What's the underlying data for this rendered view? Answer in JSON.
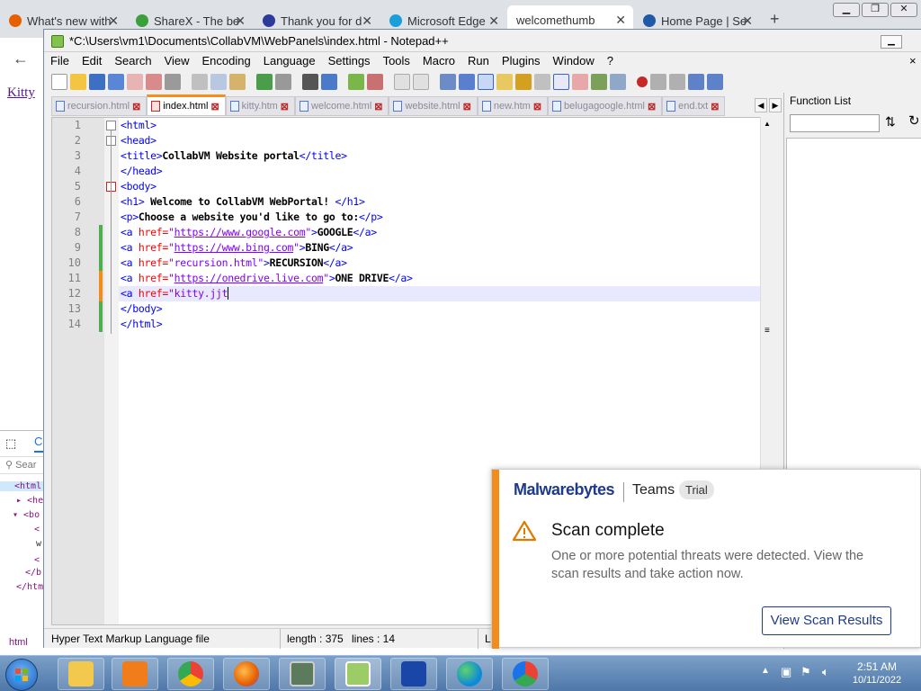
{
  "browser": {
    "tabs": [
      {
        "title": "What's new with",
        "color": "#e66000"
      },
      {
        "title": "ShareX - The be",
        "color": "#3b9f3b"
      },
      {
        "title": "Thank you for d",
        "color": "#2b3a9b"
      },
      {
        "title": "Microsoft Edge",
        "color": "#1a9fd9"
      },
      {
        "title": "welcomethumb",
        "color": ""
      },
      {
        "title": "Home Page | Se",
        "color": "#1e5aa8"
      }
    ],
    "page_link": "Kitty",
    "devtools": {
      "search_placeholder": "Sear",
      "tree": [
        "<html",
        "▸ <he",
        "▾ <bo",
        "<",
        "w",
        "<",
        "</b",
        "</htm"
      ],
      "breadcrumb": "html"
    }
  },
  "notepadpp": {
    "title": "*C:\\Users\\vm1\\Documents\\CollabVM\\WebPanels\\index.html - Notepad++",
    "menu": [
      "File",
      "Edit",
      "Search",
      "View",
      "Encoding",
      "Language",
      "Settings",
      "Tools",
      "Macro",
      "Run",
      "Plugins",
      "Window",
      "?"
    ],
    "menu_close": "×",
    "tabs": [
      {
        "name": "recursion.html",
        "active": false
      },
      {
        "name": "index.html",
        "active": true
      },
      {
        "name": "kitty.htm",
        "active": false
      },
      {
        "name": "welcome.html",
        "active": false
      },
      {
        "name": "website.html",
        "active": false
      },
      {
        "name": "new.htm",
        "active": false
      },
      {
        "name": "belugagoogle.html",
        "active": false
      },
      {
        "name": "end.txt",
        "active": false
      }
    ],
    "line_numbers": [
      "1",
      "2",
      "3",
      "4",
      "5",
      "6",
      "7",
      "8",
      "9",
      "10",
      "11",
      "12",
      "13",
      "14"
    ],
    "code": {
      "l1": "<html>",
      "l2": "<head>",
      "l3a": "<title>",
      "l3b": "CollabVM Website portal",
      "l3c": "</title>",
      "l4": "</head>",
      "l5": "<body>",
      "l6a": "<h1>",
      "l6b": " Welcome to CollabVM WebPortal! ",
      "l6c": "</h1>",
      "l7a": "<p>",
      "l7b": "Choose a website you'd like to go to:",
      "l7c": "</p>",
      "a_open": "<a ",
      "href": "href=",
      "q": "\"",
      "gt": ">",
      "l8url": "https://www.google.com",
      "l8text": "GOOGLE",
      "a_close": "</a>",
      "l9url": "https://www.bing.com",
      "l9text": "BING",
      "l10url": "recursion.html",
      "l10text": "RECURSION",
      "l11url": "https://onedrive.live.com",
      "l11text": "ONE DRIVE",
      "l12url": "kitty.jjt",
      "l13": "</body>",
      "l14": "</html>"
    },
    "function_list": {
      "title": "Function List"
    },
    "status": {
      "type": "Hyper Text Markup Language file",
      "length": "length : 375",
      "lines": "lines : 14",
      "extra": "L"
    }
  },
  "toast": {
    "brand": "Malwarebytes",
    "product": "Teams",
    "badge": "Trial",
    "title": "Scan complete",
    "message": "One or more potential threats were detected. View the scan results and take action now.",
    "button": "View Scan Results",
    "accent": "#f28c1b"
  },
  "taskbar": {
    "time": "2:51 AM",
    "date": "10/11/2022"
  }
}
